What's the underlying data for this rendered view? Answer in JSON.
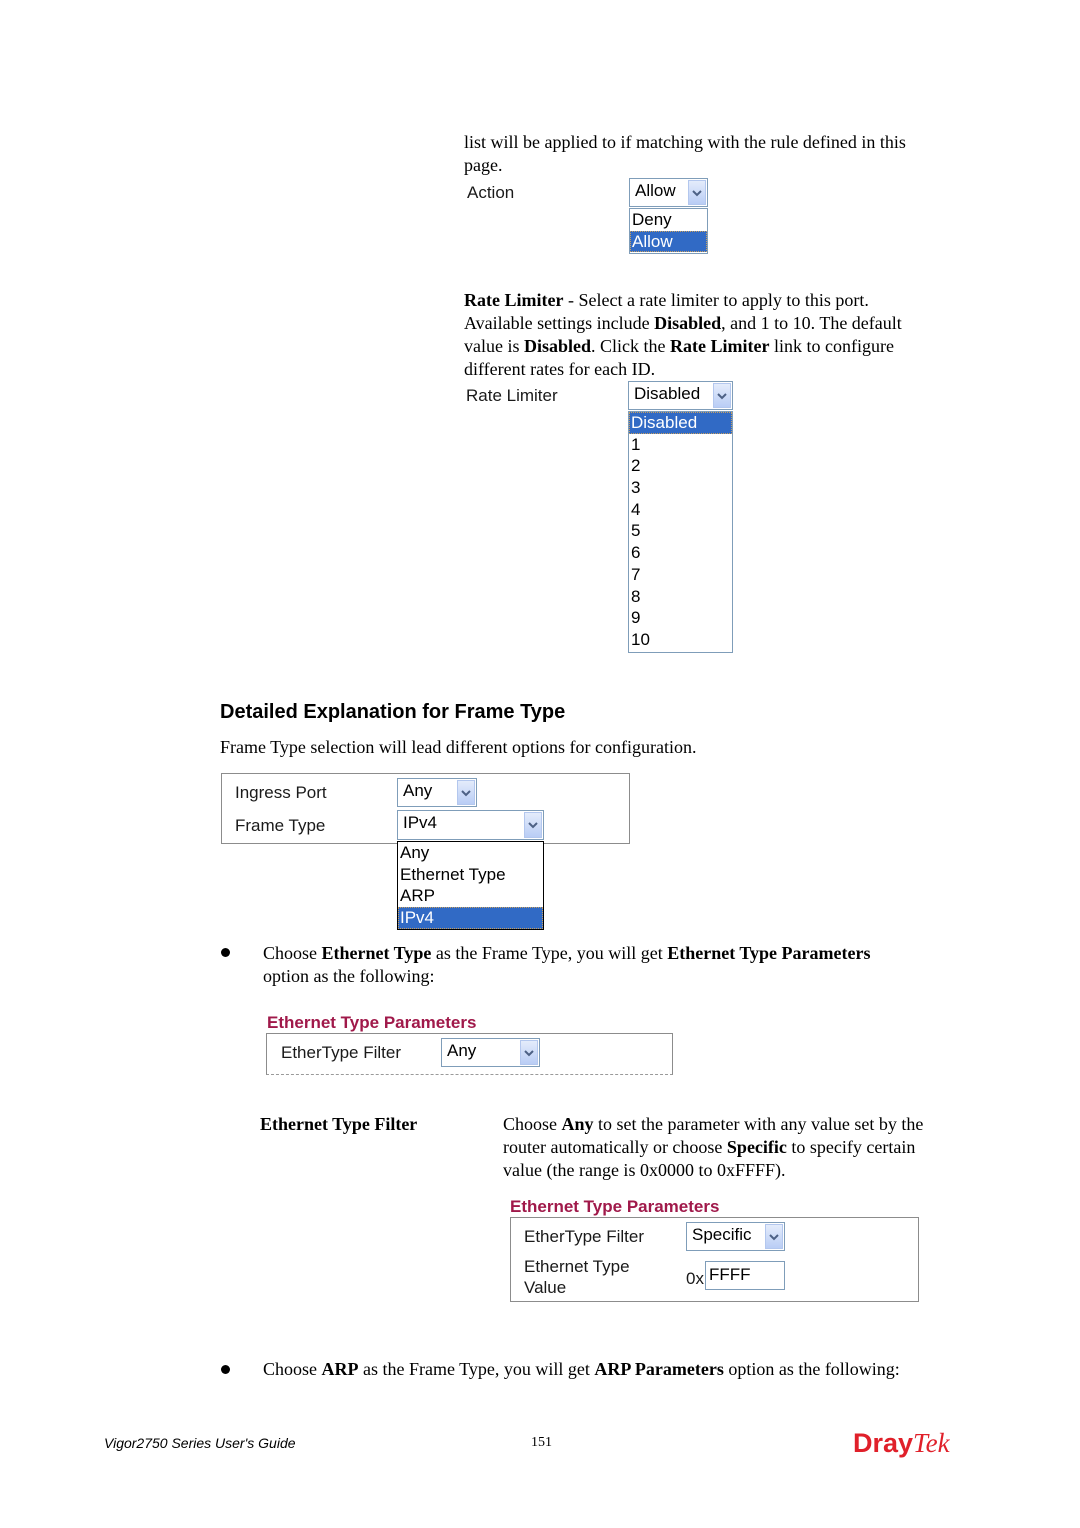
{
  "intro": {
    "line1": "list will be applied to if matching with the rule defined in this",
    "line2": "page."
  },
  "action_widget": {
    "label": "Action",
    "selected": "Allow",
    "options": [
      "Deny",
      "Allow"
    ]
  },
  "rate_limiter_text": {
    "l1_bold": "Rate Limiter",
    "l1_rest": " - Select a rate limiter to apply to this port.",
    "l2_a": "Available settings include ",
    "l2_b": "Disabled",
    "l2_c": ", and 1 to 10. The default",
    "l3_a": "value is ",
    "l3_b": "Disabled",
    "l3_c": ". Click the ",
    "l3_d": "Rate Limiter",
    "l3_e": " link to configure",
    "l4": "different rates for each ID."
  },
  "rate_limiter_widget": {
    "label": "Rate Limiter",
    "selected": "Disabled",
    "options": [
      "Disabled",
      "1",
      "2",
      "3",
      "4",
      "5",
      "6",
      "7",
      "8",
      "9",
      "10"
    ]
  },
  "section": {
    "heading": "Detailed Explanation for Frame Type",
    "intro": "Frame Type selection will lead different options for configuration."
  },
  "frame_widget": {
    "ingress_label": "Ingress Port",
    "ingress_value": "Any",
    "frame_label": "Frame Type",
    "frame_value": "IPv4",
    "options": [
      "Any",
      "Ethernet Type",
      "ARP",
      "IPv4"
    ]
  },
  "bullet1": {
    "a": "Choose ",
    "b": "Ethernet Type",
    "c": " as the Frame Type, you will get ",
    "d": "Ethernet Type Parameters",
    "e": "option as the following:"
  },
  "eth_params_1": {
    "title": "Ethernet Type Parameters",
    "filter_label": "EtherType Filter",
    "filter_value": "Any"
  },
  "eth_filter_desc": {
    "term": "Ethernet Type Filter",
    "l1_a": "Choose ",
    "l1_b": "Any",
    "l1_c": " to set the parameter with any value set by the",
    "l2_a": "router automatically or choose ",
    "l2_b": "Specific",
    "l2_c": " to specify certain",
    "l3": "value (the range is 0x0000 to 0xFFFF)."
  },
  "eth_params_2": {
    "title": "Ethernet Type Parameters",
    "filter_label": "EtherType Filter",
    "filter_value": "Specific",
    "value_label_1": "Ethernet Type",
    "value_label_2": "Value",
    "prefix": "0x",
    "value": "FFFF"
  },
  "bullet2": {
    "a": "Choose ",
    "b": "ARP",
    "c": " as the Frame Type, you will get ",
    "d": "ARP Parameters",
    "e": " option as the following:"
  },
  "footer": {
    "guide": "Vigor2750 Series User's Guide",
    "page": "151",
    "logo_a": "Dray",
    "logo_b": "Tek"
  },
  "colors": {
    "selection": "#316ac5",
    "param_title": "#a0194a",
    "logo": "#e0202a"
  }
}
